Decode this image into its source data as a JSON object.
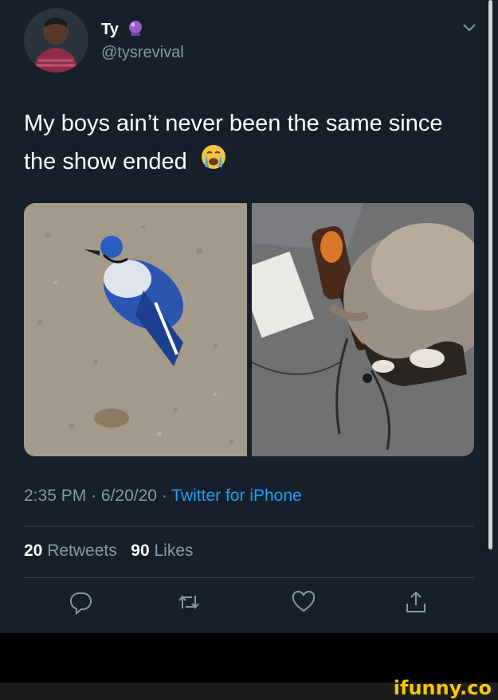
{
  "user": {
    "display_name": "Ty",
    "handle": "@tysrevival",
    "badge_icon": "crystal-ball-icon"
  },
  "tweet": {
    "text": "My boys ain’t never been the same since the show ended",
    "emoji": "loudly-crying-face-icon",
    "time": "2:35 PM",
    "date": "6/20/20",
    "separator": "·",
    "client": "Twitter for iPhone"
  },
  "stats": {
    "retweets_count": "20",
    "retweets_label": "Retweets",
    "likes_count": "90",
    "likes_label": "Likes"
  },
  "actions": [
    "reply-icon",
    "retweet-icon",
    "like-icon",
    "share-icon"
  ],
  "media": [
    "photo-dead-blue-jay",
    "photo-raccoon-with-bottle"
  ],
  "watermark": "ifunny.co",
  "colors": {
    "background": "#15202b",
    "text": "#ffffff",
    "muted": "#8899a6",
    "link": "#1da1f2",
    "divider": "#38444d",
    "watermark": "#f7c600"
  }
}
